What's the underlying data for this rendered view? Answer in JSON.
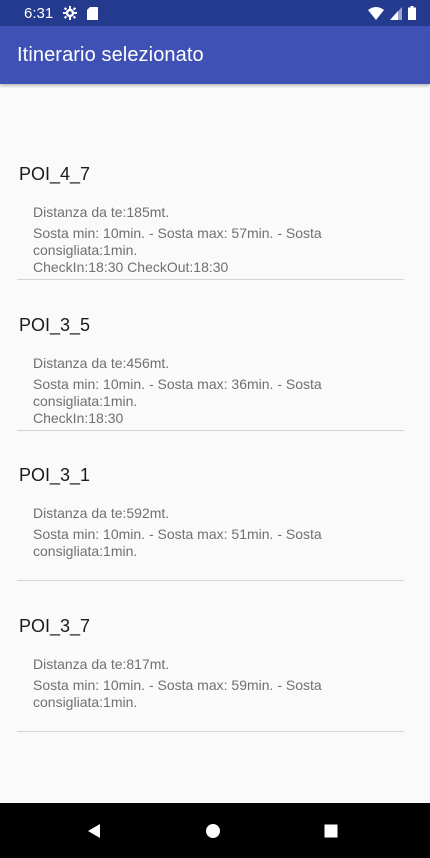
{
  "status_bar": {
    "time": "6:31",
    "icons": [
      "gear-icon",
      "sd-card-icon",
      "wifi-icon",
      "signal-icon",
      "battery-icon"
    ]
  },
  "app_bar": {
    "title": "Itinerario selezionato",
    "color": "#3f51b5"
  },
  "pois": [
    {
      "name": "POI_4_7",
      "distance": "Distanza da te:185mt.",
      "sosta": "Sosta min: 10min. - Sosta max: 57min. - Sosta consigliata:1min.",
      "check": "CheckIn:18:30 CheckOut:18:30"
    },
    {
      "name": "POI_3_5",
      "distance": "Distanza da te:456mt.",
      "sosta": "Sosta min: 10min. - Sosta max: 36min. - Sosta consigliata:1min.",
      "check": "CheckIn:18:30"
    },
    {
      "name": "POI_3_1",
      "distance": "Distanza da te:592mt.",
      "sosta": "Sosta min: 10min. - Sosta max: 51min. - Sosta consigliata:1min.",
      "check": ""
    },
    {
      "name": "POI_3_7",
      "distance": "Distanza da te:817mt.",
      "sosta": "Sosta min: 10min. - Sosta max: 59min. - Sosta consigliata:1min.",
      "check": ""
    }
  ],
  "nav_bar": {
    "buttons": [
      "back-icon",
      "home-icon",
      "recents-icon"
    ]
  }
}
